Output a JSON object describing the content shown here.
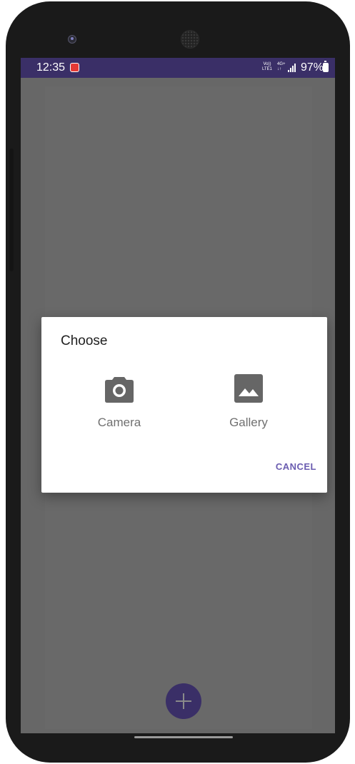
{
  "status_bar": {
    "time": "12:35",
    "network_top": "Vo))",
    "network_bottom": "LTE1",
    "network_type_top": "4G+",
    "network_type_bottom": "↓↑",
    "battery_percent": "97%",
    "battery_level": 0.97
  },
  "dialog": {
    "title": "Choose",
    "options": [
      {
        "label": "Camera",
        "icon": "camera-icon"
      },
      {
        "label": "Gallery",
        "icon": "image-icon"
      }
    ],
    "cancel_label": "CANCEL"
  },
  "fab": {
    "icon": "plus-icon"
  },
  "colors": {
    "status_bar": "#3a2f67",
    "scrim": "#676767",
    "accent": "#6a5cb0",
    "icon": "#666666"
  }
}
